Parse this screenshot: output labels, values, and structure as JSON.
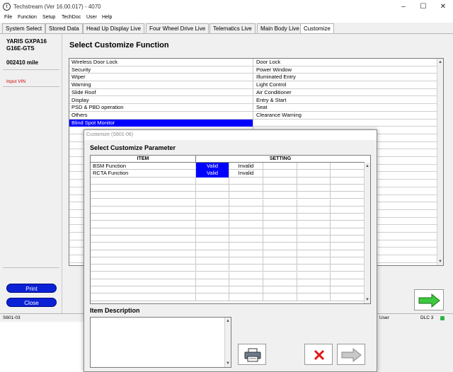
{
  "window": {
    "title": "Techstream (Ver 16.00.017) - 4070",
    "min": "–",
    "max": "☐",
    "close": "✕"
  },
  "menu": [
    "File",
    "Function",
    "Setup",
    "TechDoc",
    "User",
    "Help"
  ],
  "tabs": [
    {
      "label": "System Select",
      "active": false
    },
    {
      "label": "Stored Data",
      "active": false
    },
    {
      "label": "Head Up Display Live",
      "active": false
    },
    {
      "label": "Four Wheel Drive Live",
      "active": false
    },
    {
      "label": "Telematics Live",
      "active": false
    },
    {
      "label": "Main Body Live",
      "active": false
    },
    {
      "label": "Customize",
      "active": true
    }
  ],
  "vehicle": {
    "model_line1": "YARIS GXPA16",
    "model_line2": "G16E-GTS",
    "mileage": "002410 mile",
    "input_vin": "Input VIN"
  },
  "left_buttons": {
    "print": "Print",
    "close": "Close"
  },
  "main": {
    "title": "Select Customize Function",
    "functions_left": [
      "Wireless Door Lock",
      "Security",
      "Wiper",
      "Warning",
      "Slide Roof",
      "Display",
      "PSD & PBD operation",
      "Others",
      "Blind Spot Monitor"
    ],
    "functions_right": [
      "Door Lock",
      "Power Window",
      "Illuminated Entry",
      "Light Control",
      "Air Conditioner",
      "Entry & Start",
      "Seat",
      "Clearance Warning"
    ],
    "selected_index": 8
  },
  "status": {
    "left": "S601-03",
    "user": "User",
    "dlc": "DLC 3"
  },
  "modal": {
    "title": "Customize (S601-06)",
    "heading": "Select Customize Parameter",
    "col_item": "ITEM",
    "col_setting": "SETTING",
    "params": [
      {
        "item": "BSM Function",
        "settings": [
          "Valid",
          "Invalid"
        ],
        "selected": 0
      },
      {
        "item": "RCTA Function",
        "settings": [
          "Valid",
          "Invalid"
        ],
        "selected": 0
      }
    ],
    "desc_label": "Item Description",
    "desc_text": ""
  },
  "colors": {
    "selection": "#0000ff",
    "button_blue": "#0b21d6",
    "vin_red": "#d00000",
    "dlc_green": "#2fb344"
  }
}
